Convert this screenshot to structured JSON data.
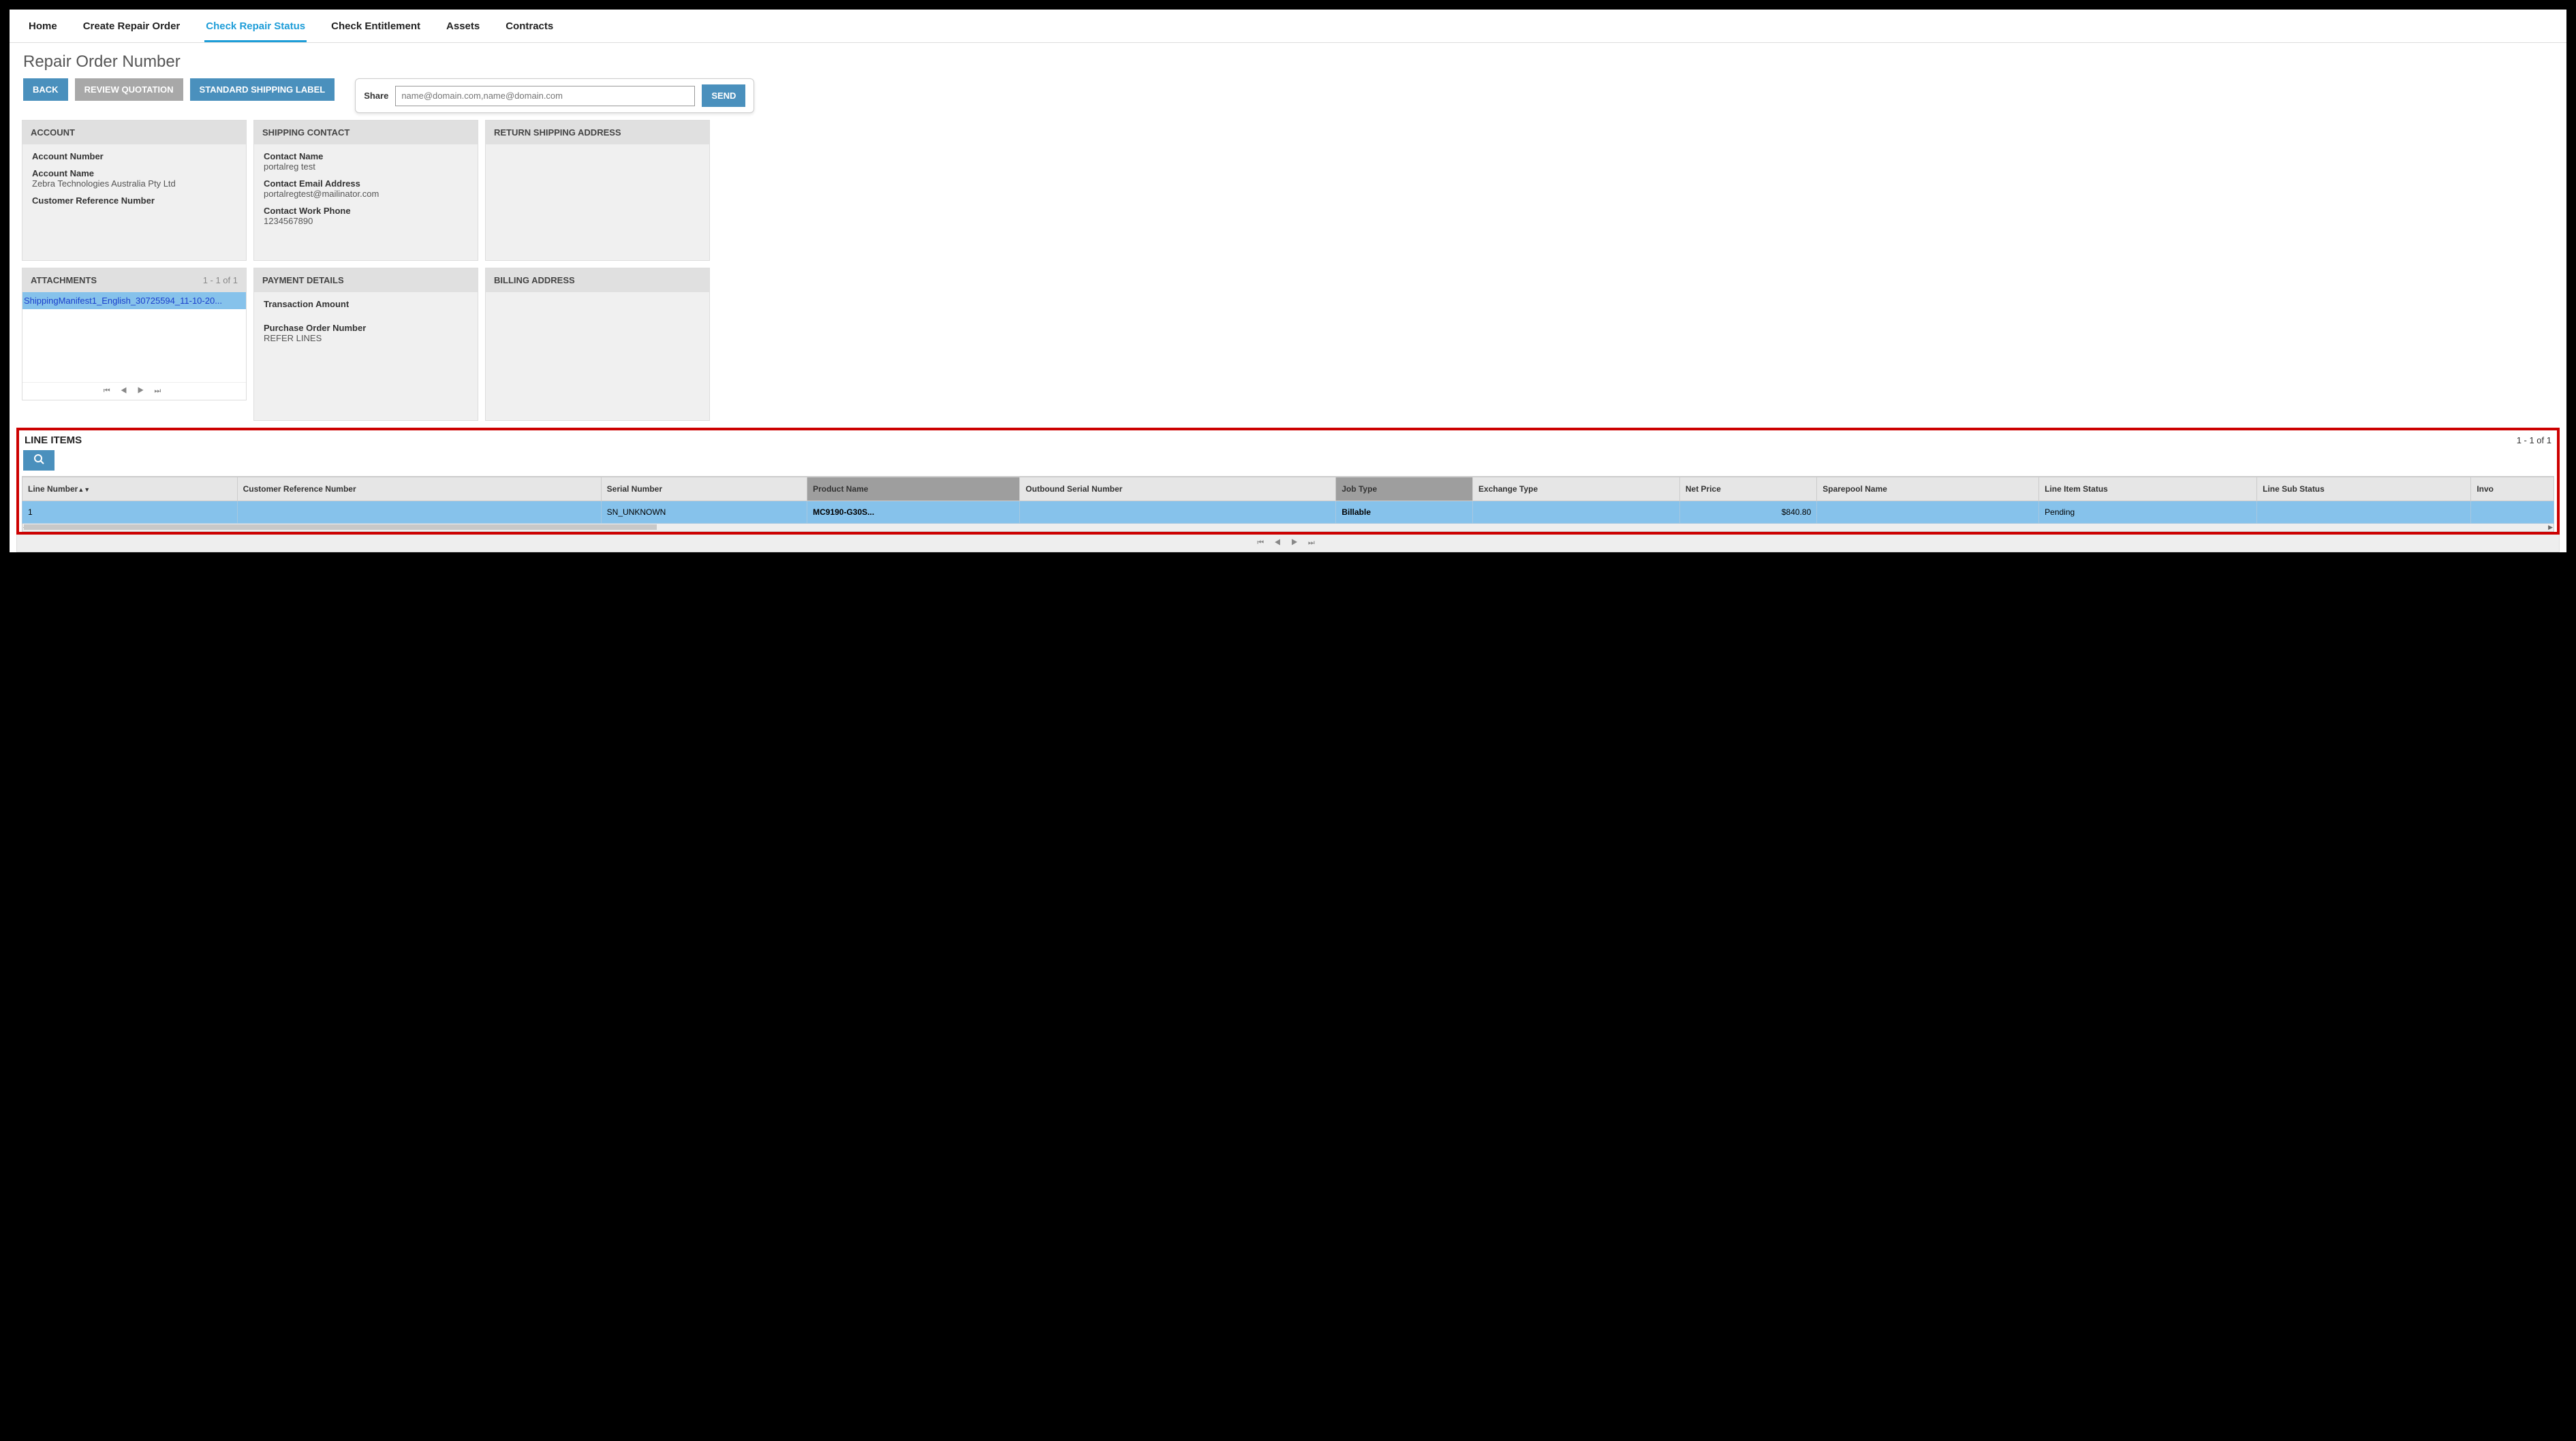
{
  "nav": {
    "items": [
      {
        "label": "Home"
      },
      {
        "label": "Create Repair Order"
      },
      {
        "label": "Check Repair Status",
        "active": true
      },
      {
        "label": "Check Entitlement"
      },
      {
        "label": "Assets"
      },
      {
        "label": "Contracts"
      }
    ]
  },
  "page_title": "Repair Order Number",
  "buttons": {
    "back": "BACK",
    "review_quotation": "REVIEW QUOTATION",
    "standard_shipping_label": "STANDARD SHIPPING LABEL",
    "send": "SEND"
  },
  "share": {
    "label": "Share",
    "placeholder": "name@domain.com,name@domain.com"
  },
  "panels": {
    "account": {
      "title": "ACCOUNT",
      "account_number_label": "Account Number",
      "account_number_value": "",
      "account_name_label": "Account Name",
      "account_name_value": "Zebra Technologies Australia Pty Ltd",
      "cust_ref_label": "Customer Reference Number",
      "cust_ref_value": ""
    },
    "shipping_contact": {
      "title": "SHIPPING CONTACT",
      "contact_name_label": "Contact Name",
      "contact_name_value": "portalreg test",
      "email_label": "Contact Email Address",
      "email_value": "portalregtest@mailinator.com",
      "phone_label": "Contact Work Phone",
      "phone_value": "1234567890"
    },
    "return_shipping": {
      "title": "RETURN SHIPPING ADDRESS"
    },
    "attachments": {
      "title": "ATTACHMENTS",
      "count": "1 - 1 of 1",
      "items": [
        {
          "name": "ShippingManifest1_English_30725594_11-10-20..."
        }
      ]
    },
    "payment": {
      "title": "PAYMENT DETAILS",
      "trans_amount_label": "Transaction Amount",
      "trans_amount_value": "",
      "po_label": "Purchase Order Number",
      "po_value": "REFER LINES"
    },
    "billing": {
      "title": "BILLING ADDRESS"
    }
  },
  "line_items": {
    "title": "LINE ITEMS",
    "count": "1 - 1 of 1",
    "columns": [
      "Line Number",
      "Customer Reference Number",
      "Serial Number",
      "Product Name",
      "Outbound Serial Number",
      "Job Type",
      "Exchange Type",
      "Net Price",
      "Sparepool Name",
      "Line Item Status",
      "Line Sub Status",
      "Invo"
    ],
    "rows": [
      {
        "line_number": "1",
        "customer_ref": "",
        "serial": "SN_UNKNOWN",
        "product": "MC9190-G30S...",
        "outbound_serial": "",
        "job_type": "Billable",
        "exchange_type": "",
        "net_price": "$840.80",
        "sparepool": "",
        "status": "Pending",
        "sub_status": "",
        "invo": ""
      }
    ]
  },
  "pager_glyphs": "⏮ ◀ ▶ ⏭"
}
